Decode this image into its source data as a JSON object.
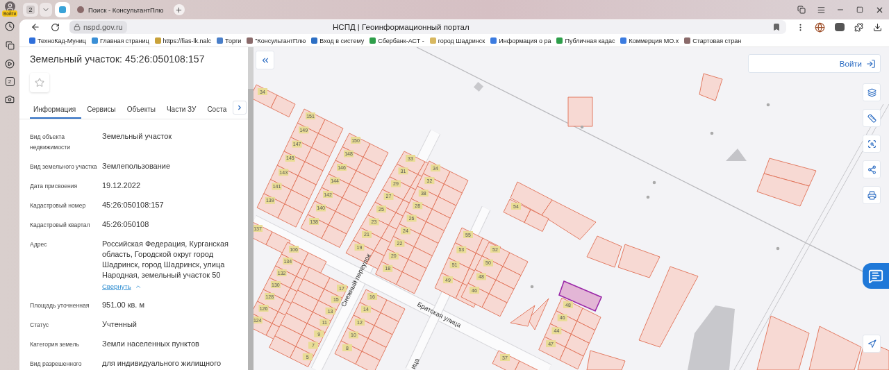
{
  "browser": {
    "profile_label": "Войти",
    "tab_group_count": "2",
    "tabs": [
      {
        "kind": "pinned",
        "selected": true
      },
      {
        "kind": "page",
        "title": "Поиск - КонсультантПлю",
        "selected": false
      }
    ],
    "sidebar_badge": "2",
    "address": "nspd.gov.ru",
    "page_title": "НСПД | Геоинформационный портал",
    "bookmarks": [
      {
        "label": "ТехноКад-Муниц",
        "color": "#2f6fdb"
      },
      {
        "label": "Главная страниц",
        "color": "#3a8fd6"
      },
      {
        "label": "https://fias-lk.nalc",
        "color": "#c9a23a"
      },
      {
        "label": "Торги",
        "color": "#4a7fc9"
      },
      {
        "label": "\"КонсультантПлю",
        "color": "#8a6a6a"
      },
      {
        "label": "Вход в систему",
        "color": "#2d6fc4"
      },
      {
        "label": "Сбербанк-АСТ -",
        "color": "#2e9e4a"
      },
      {
        "label": "город Шадринск",
        "color": "#d8b860"
      },
      {
        "label": "Информация о ра",
        "color": "#3b7be0"
      },
      {
        "label": "Публичная кадас",
        "color": "#2e9e4a"
      },
      {
        "label": "Коммерция МО.х",
        "color": "#3b7be0"
      },
      {
        "label": "Стартовая стран",
        "color": "#8a6a6a"
      }
    ]
  },
  "panel": {
    "title": "Земельный участок: 45:26:050108:157",
    "favorite": false,
    "tabs": [
      {
        "label": "Информация",
        "selected": true
      },
      {
        "label": "Сервисы",
        "selected": false
      },
      {
        "label": "Объекты",
        "selected": false
      },
      {
        "label": "Части ЗУ",
        "selected": false
      },
      {
        "label": "Соста",
        "selected": false
      }
    ],
    "fields": [
      {
        "label": "Вид объекта недвижимости",
        "value": "Земельный участок"
      },
      {
        "label": "Вид земельного участка",
        "value": "Землепользование"
      },
      {
        "label": "Дата присвоения",
        "value": "19.12.2022"
      },
      {
        "label": "Кадастровый номер",
        "value": "45:26:050108:157"
      },
      {
        "label": "Кадастровый квартал",
        "value": "45:26:050108"
      },
      {
        "label": "Адрес",
        "value": "Российская Федерация, Курганская область, Городской округ город Шадринск, город Шадринск, улица Народная, земельный участок 50",
        "link": "Свернуть"
      },
      {
        "label": "Площадь уточненная",
        "value": "951.00 кв. м"
      },
      {
        "label": "Статус",
        "value": "Учтенный"
      },
      {
        "label": "Категория земель",
        "value": "Земли населенных пунктов"
      },
      {
        "label": "Вид разрешенного",
        "value": "для индивидуального жилищного"
      }
    ]
  },
  "map": {
    "login": "Войти",
    "blocks": [
      {
        "labels": [
          "34"
        ]
      },
      {
        "labels": [
          "151",
          "149",
          "147",
          "145",
          "143",
          "141",
          "139"
        ]
      },
      {
        "labels": [
          "150",
          "148",
          "146",
          "144",
          "142",
          "140",
          "138"
        ]
      },
      {
        "labels": [
          "33",
          "31",
          "29",
          "27",
          "25",
          "23",
          "21",
          "19"
        ]
      },
      {
        "labels": [
          "34",
          "32",
          "38",
          "28",
          "26",
          "24",
          "22",
          "20",
          "18"
        ]
      },
      {
        "labels": [
          "54"
        ]
      },
      {
        "labels": [
          "137"
        ]
      },
      {
        "labels": [
          "106",
          "134",
          "132",
          "130",
          "128",
          "126",
          "124"
        ]
      },
      {
        "labels": [
          "55",
          "53",
          "51",
          "49"
        ]
      },
      {
        "labels": [
          "52",
          "50",
          "48",
          "46"
        ]
      },
      {
        "labels": [
          "17",
          "15",
          "13",
          "11",
          "9",
          "7",
          "5"
        ]
      },
      {
        "labels": [
          "16",
          "14",
          "12",
          "10",
          "8"
        ]
      },
      {
        "labels": [
          "48",
          "46",
          "44",
          "47"
        ]
      },
      {
        "labels": [
          "37"
        ]
      }
    ],
    "streets": [
      "Снежный переулок",
      "Братская улица",
      "ица"
    ]
  }
}
